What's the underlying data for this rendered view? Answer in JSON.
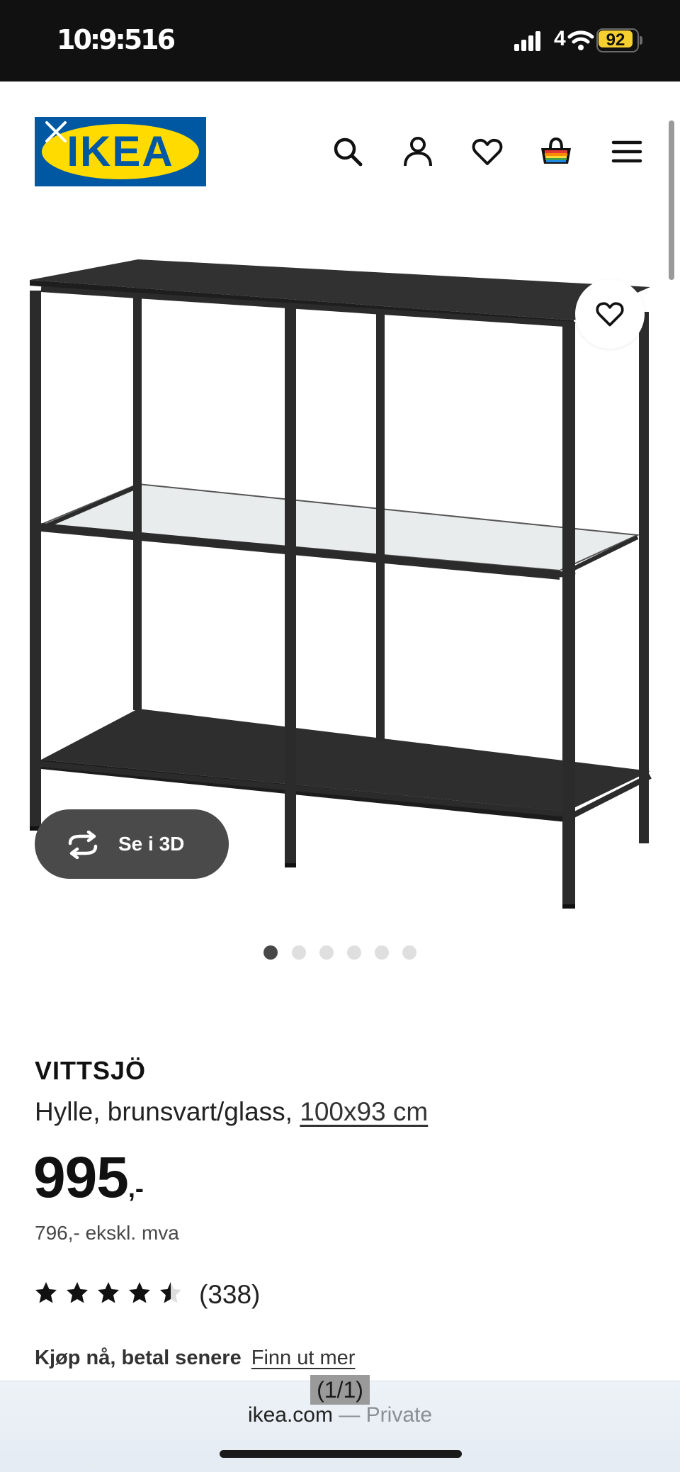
{
  "status_bar": {
    "time": "10:9:516",
    "network": "4",
    "battery": "92",
    "icons": [
      "signal-icon",
      "wifi-icon",
      "battery-icon"
    ]
  },
  "header": {
    "logo_text": "IKEA",
    "icons": [
      "close-icon",
      "search-icon",
      "profile-icon",
      "heart-icon",
      "cart-icon",
      "menu-icon"
    ]
  },
  "gallery": {
    "view_3d_label": "Se i 3D",
    "dot_count": 6,
    "active_dot": 1
  },
  "product": {
    "name": "VITTSJÖ",
    "description": "Hylle, brunsvart/glass,",
    "size": "100x93 cm",
    "price": "995",
    "price_suffix": ",-",
    "price_ex_vat": "796,- ekskl. mva",
    "rating_value": 4.5,
    "rating_count": "(338)",
    "bnpl_label": "Kjøp nå, betal senere",
    "bnpl_link": "Finn ut mer"
  },
  "browser": {
    "find_counter": "(1/1)",
    "url": "ikea.com",
    "mode": "— Private"
  },
  "colors": {
    "ikea_blue": "#0058a3",
    "ikea_yellow": "#ffdb00",
    "shelf_frame": "#2b2b2b"
  }
}
